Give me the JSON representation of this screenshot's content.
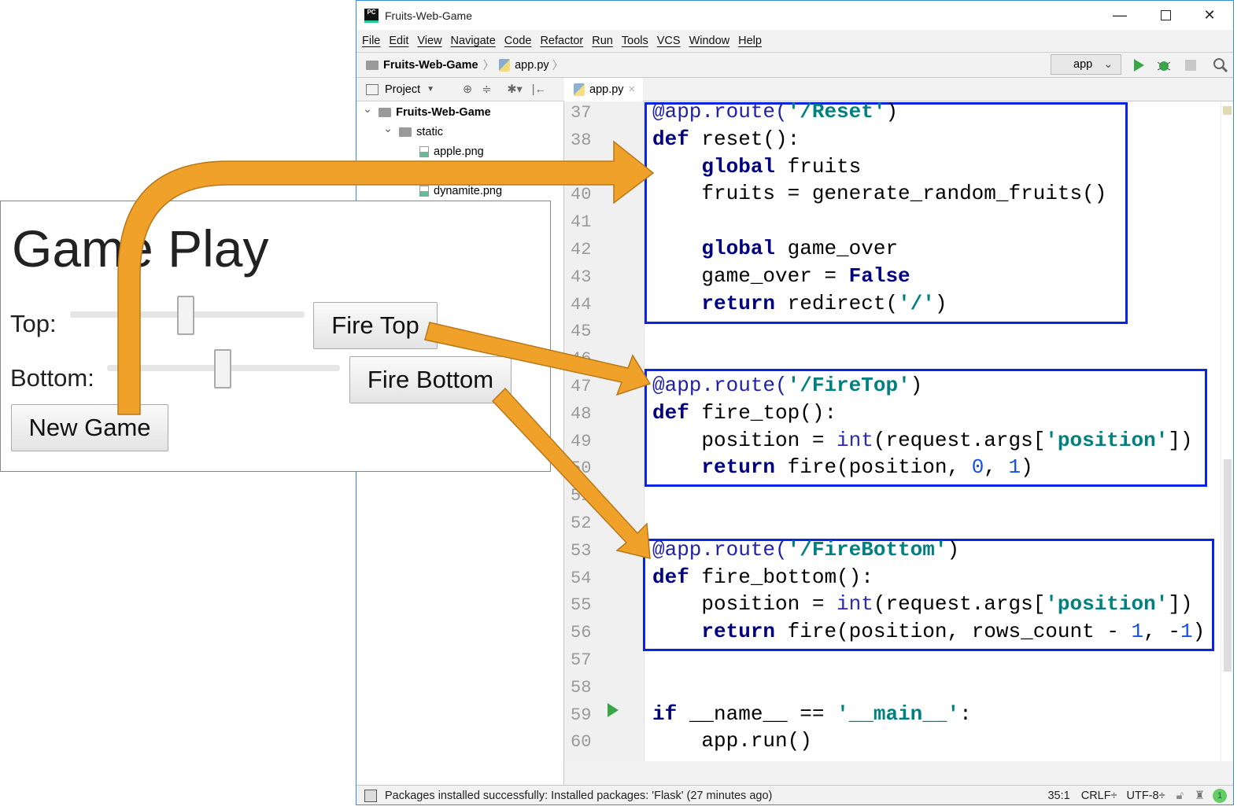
{
  "window": {
    "title": "Fruits-Web-Game",
    "minimize": "—",
    "maximize": "☐",
    "close": "✕"
  },
  "menu": [
    "File",
    "Edit",
    "View",
    "Navigate",
    "Code",
    "Refactor",
    "Run",
    "Tools",
    "VCS",
    "Window",
    "Help"
  ],
  "breadcrumb": {
    "project": "Fruits-Web-Game",
    "file": "app.py"
  },
  "toolbar": {
    "run_config": "app"
  },
  "project_panel": {
    "title": "Project",
    "tree": [
      {
        "label": "Fruits-Web-Game",
        "level": 0,
        "type": "folder",
        "expanded": true
      },
      {
        "label": "static",
        "level": 1,
        "type": "folder",
        "expanded": true
      },
      {
        "label": "apple.png",
        "level": 2,
        "type": "file"
      },
      {
        "label": "dynamite.png",
        "level": 2,
        "type": "file"
      }
    ]
  },
  "editor": {
    "tab": "app.py",
    "lines": [
      {
        "n": "37",
        "tokens": [
          [
            "@app.route(",
            "dec"
          ],
          [
            "'/Reset'",
            "str"
          ],
          [
            ")",
            "p"
          ]
        ]
      },
      {
        "n": "38",
        "tokens": [
          [
            "def",
            "kw"
          ],
          [
            " reset():",
            "p"
          ]
        ]
      },
      {
        "n": "39",
        "tokens": [
          [
            "    ",
            "p"
          ],
          [
            "global",
            "kw"
          ],
          [
            " fruits",
            "p"
          ]
        ]
      },
      {
        "n": "40",
        "tokens": [
          [
            "    fruits = generate_random_fruits()",
            "p"
          ]
        ]
      },
      {
        "n": "41",
        "tokens": []
      },
      {
        "n": "42",
        "tokens": [
          [
            "    ",
            "p"
          ],
          [
            "global",
            "kw"
          ],
          [
            " game_over",
            "p"
          ]
        ]
      },
      {
        "n": "43",
        "tokens": [
          [
            "    game_over = ",
            "p"
          ],
          [
            "False",
            "kw"
          ]
        ]
      },
      {
        "n": "44",
        "tokens": [
          [
            "    ",
            "p"
          ],
          [
            "return",
            "kw"
          ],
          [
            " redirect(",
            "p"
          ],
          [
            "'/'",
            "str"
          ],
          [
            ")",
            "p"
          ]
        ]
      },
      {
        "n": "45",
        "tokens": []
      },
      {
        "n": "46",
        "tokens": []
      },
      {
        "n": "47",
        "tokens": [
          [
            "@app.route(",
            "dec"
          ],
          [
            "'/FireTop'",
            "str"
          ],
          [
            ")",
            "p"
          ]
        ]
      },
      {
        "n": "48",
        "tokens": [
          [
            "def",
            "kw"
          ],
          [
            " fire_top():",
            "p"
          ]
        ]
      },
      {
        "n": "49",
        "tokens": [
          [
            "    position = ",
            "p"
          ],
          [
            "int",
            "bi"
          ],
          [
            "(request.args[",
            "p"
          ],
          [
            "'position'",
            "str"
          ],
          [
            "])",
            "p"
          ]
        ]
      },
      {
        "n": "50",
        "tokens": [
          [
            "    ",
            "p"
          ],
          [
            "return",
            "kw"
          ],
          [
            " fire(position, ",
            "p"
          ],
          [
            "0",
            "num"
          ],
          [
            ", ",
            "p"
          ],
          [
            "1",
            "num"
          ],
          [
            ")",
            "p"
          ]
        ]
      },
      {
        "n": "51",
        "tokens": []
      },
      {
        "n": "52",
        "tokens": []
      },
      {
        "n": "53",
        "tokens": [
          [
            "@app.route(",
            "dec"
          ],
          [
            "'/FireBottom'",
            "str"
          ],
          [
            ")",
            "p"
          ]
        ]
      },
      {
        "n": "54",
        "tokens": [
          [
            "def",
            "kw"
          ],
          [
            " fire_bottom():",
            "p"
          ]
        ]
      },
      {
        "n": "55",
        "tokens": [
          [
            "    position = ",
            "p"
          ],
          [
            "int",
            "bi"
          ],
          [
            "(request.args[",
            "p"
          ],
          [
            "'position'",
            "str"
          ],
          [
            "])",
            "p"
          ]
        ]
      },
      {
        "n": "56",
        "tokens": [
          [
            "    ",
            "p"
          ],
          [
            "return",
            "kw"
          ],
          [
            " fire(position, rows_count - ",
            "p"
          ],
          [
            "1",
            "num"
          ],
          [
            ", -",
            "p"
          ],
          [
            "1",
            "num"
          ],
          [
            ")",
            "p"
          ]
        ]
      },
      {
        "n": "57",
        "tokens": []
      },
      {
        "n": "58",
        "tokens": []
      },
      {
        "n": "59",
        "tokens": [
          [
            "if",
            "kw"
          ],
          [
            " __name__ == ",
            "p"
          ],
          [
            "'__main__'",
            "str"
          ],
          [
            ":",
            "p"
          ]
        ]
      },
      {
        "n": "60",
        "tokens": [
          [
            "    app.run()",
            "p"
          ]
        ]
      }
    ]
  },
  "status": {
    "message": "Packages installed successfully: Installed packages: 'Flask' (27 minutes ago)",
    "position": "35:1",
    "line_sep": "CRLF÷",
    "encoding": "UTF-8÷",
    "events": "1"
  },
  "game": {
    "title": "Game Play",
    "top_label": "Top:",
    "bottom_label": "Bottom:",
    "fire_top": "Fire Top",
    "fire_bottom": "Fire Bottom",
    "new_game": "New Game",
    "top_slider_value": 0.5,
    "bottom_slider_value": 0.5
  },
  "colors": {
    "keyword": "#000080",
    "string": "#008080",
    "decorator": "#1f1fa8",
    "number": "#1750eb",
    "builtin": "#2a2ab0",
    "highlight_box": "#0a24e6",
    "arrow": "#f0a12a"
  }
}
